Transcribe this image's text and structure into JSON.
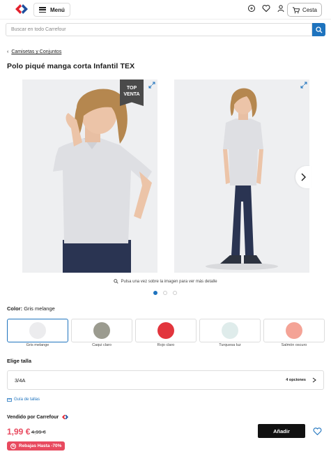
{
  "header": {
    "menu_label": "Menú",
    "cart_label": "Cesta",
    "icons": [
      "chat-icon",
      "heart-icon",
      "user-icon",
      "cart-icon"
    ]
  },
  "search": {
    "placeholder": "Buscar en todo Carrefour"
  },
  "breadcrumb": {
    "label": "Camisetas y Conjuntos"
  },
  "product": {
    "title": "Polo piqué manga corta Infantil TEX",
    "badge_line1": "TOP",
    "badge_line2": "VENTA",
    "image_hint": "Pulsa una vez sobre la imagen para ver más detalle",
    "carousel": {
      "total": 3,
      "active": 1
    }
  },
  "color": {
    "label": "Color:",
    "selected": "Gris melange",
    "options": [
      {
        "name": "Gris melange",
        "hex": "#ececee"
      },
      {
        "name": "Caqui claro",
        "hex": "#9b9b8f"
      },
      {
        "name": "Rojo claro",
        "hex": "#e2353d"
      },
      {
        "name": "Turquesa luz",
        "hex": "#dfeceb"
      },
      {
        "name": "Salmón oscuro",
        "hex": "#f4a396"
      }
    ]
  },
  "size": {
    "label": "Elige talla",
    "value": "3/4A",
    "options_label": "4 opciones",
    "guide_label": "Guía de tallas"
  },
  "purchase": {
    "seller_label": "Vendido por Carrefour",
    "price": "1,99 €",
    "old_price": "4,99 €",
    "promo_label": "Rebajas Hasta -70%",
    "add_label": "Añadir"
  },
  "colors": {
    "accent": "#1e73be",
    "price": "#e84a5f",
    "button": "#111111"
  }
}
